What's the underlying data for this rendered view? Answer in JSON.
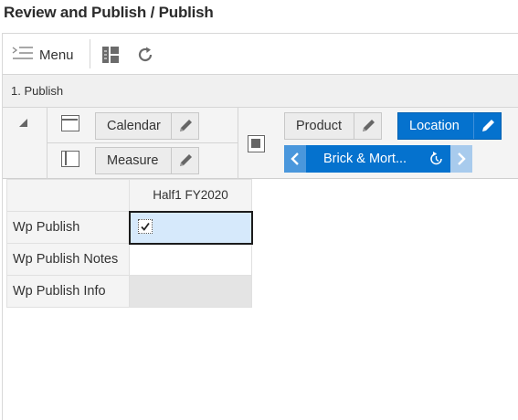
{
  "page": {
    "title": "Review and Publish / Publish"
  },
  "toolbar": {
    "menu_label": "Menu",
    "icons": [
      "menu-icon",
      "grid-layout-icon",
      "refresh-icon"
    ]
  },
  "section": {
    "label": "1. Publish"
  },
  "pivot": {
    "rows_tiles": [
      {
        "label": "Calendar",
        "active": false
      },
      {
        "label": "Measure",
        "active": false
      }
    ],
    "column_tiles": [
      {
        "label": "Product",
        "active": false
      },
      {
        "label": "Location",
        "active": true
      }
    ],
    "page_navigator": {
      "label": "Brick & Mort...",
      "icons": [
        "chevron-left-icon",
        "reset-icon",
        "chevron-right-icon"
      ]
    }
  },
  "grid": {
    "column_header": "Half1 FY2020",
    "rows": [
      {
        "label": "Wp Publish",
        "value": "checked",
        "selected": true
      },
      {
        "label": "Wp Publish Notes",
        "value": ""
      },
      {
        "label": "Wp Publish Info",
        "value": "",
        "readonly": true
      }
    ]
  },
  "colors": {
    "accent": "#0572ce",
    "selection": "#d6e9fb",
    "header_bg": "#f4f4f4"
  }
}
